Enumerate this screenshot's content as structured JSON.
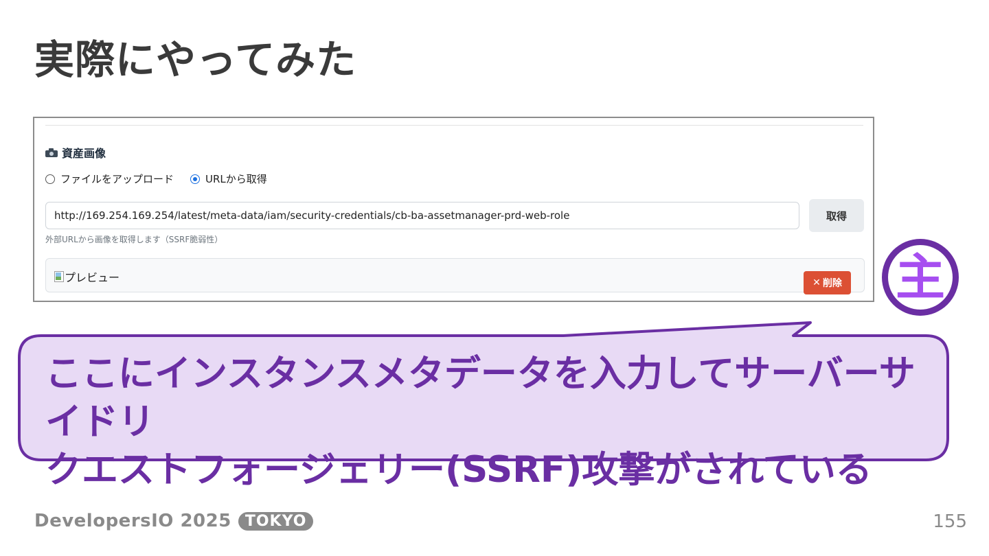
{
  "slide": {
    "title": "実際にやってみた",
    "page_number": "155"
  },
  "app": {
    "section_heading": "資産画像",
    "section_icon": "camera-icon",
    "upload_options": [
      {
        "label": "ファイルをアップロード",
        "checked": false
      },
      {
        "label": "URLから取得",
        "checked": true
      }
    ],
    "url_value": "http://169.254.169.254/latest/meta-data/iam/security-credentials/cb-ba-assetmanager-prd-web-role",
    "fetch_button_label": "取得",
    "helper_text": "外部URLから画像を取得します（SSRF脆弱性）",
    "preview_alt": "プレビュー",
    "delete_button_label": "削除",
    "delete_icon": "close-icon"
  },
  "callout": {
    "line1": "ここにインスタンスメタデータを入力してサーバーサイドリ",
    "line2": "クエストフォージェリー(SSRF)攻撃がされている"
  },
  "badge": {
    "char": "主"
  },
  "footer": {
    "brand": "DevelopersIO 2025",
    "badge": "TOKYO"
  },
  "colors": {
    "accent_purple": "#6a2ea3",
    "callout_fill": "#e8daf5",
    "badge_char": "#a64ef0",
    "delete_red": "#dc5034",
    "radio_blue": "#1a6fe0"
  }
}
